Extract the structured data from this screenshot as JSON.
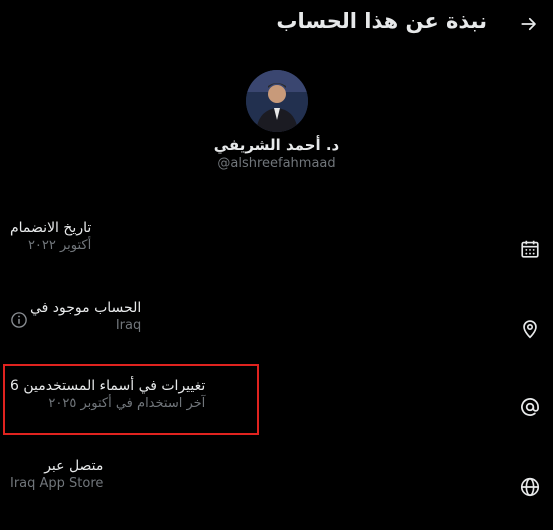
{
  "header": {
    "title": "نبذة عن هذا الحساب",
    "back_icon": "arrow-right-icon"
  },
  "profile": {
    "display_name": "د. أحمد الشريفي",
    "handle": "@alshreefahmaad"
  },
  "rows": [
    {
      "icon": "calendar-icon",
      "title": "تاريخ الانضمام",
      "subtitle": "أكتوبر ٢٠٢٢"
    },
    {
      "icon": "location-pin-icon",
      "title": "الحساب موجود في",
      "subtitle": "Iraq",
      "extra_icon": "info-icon"
    },
    {
      "icon": "at-sign-icon",
      "title": "تغييرات في أسماء المستخدمين 6",
      "subtitle": "آخر استخدام في أكتوبر ٢٠٢٥"
    },
    {
      "icon": "globe-icon",
      "title": "متصل عبر",
      "subtitle": "Iraq App Store"
    }
  ],
  "colors": {
    "background": "#000000",
    "text": "#e7e9ea",
    "secondary": "#71767b",
    "highlight": "#e0231f"
  }
}
